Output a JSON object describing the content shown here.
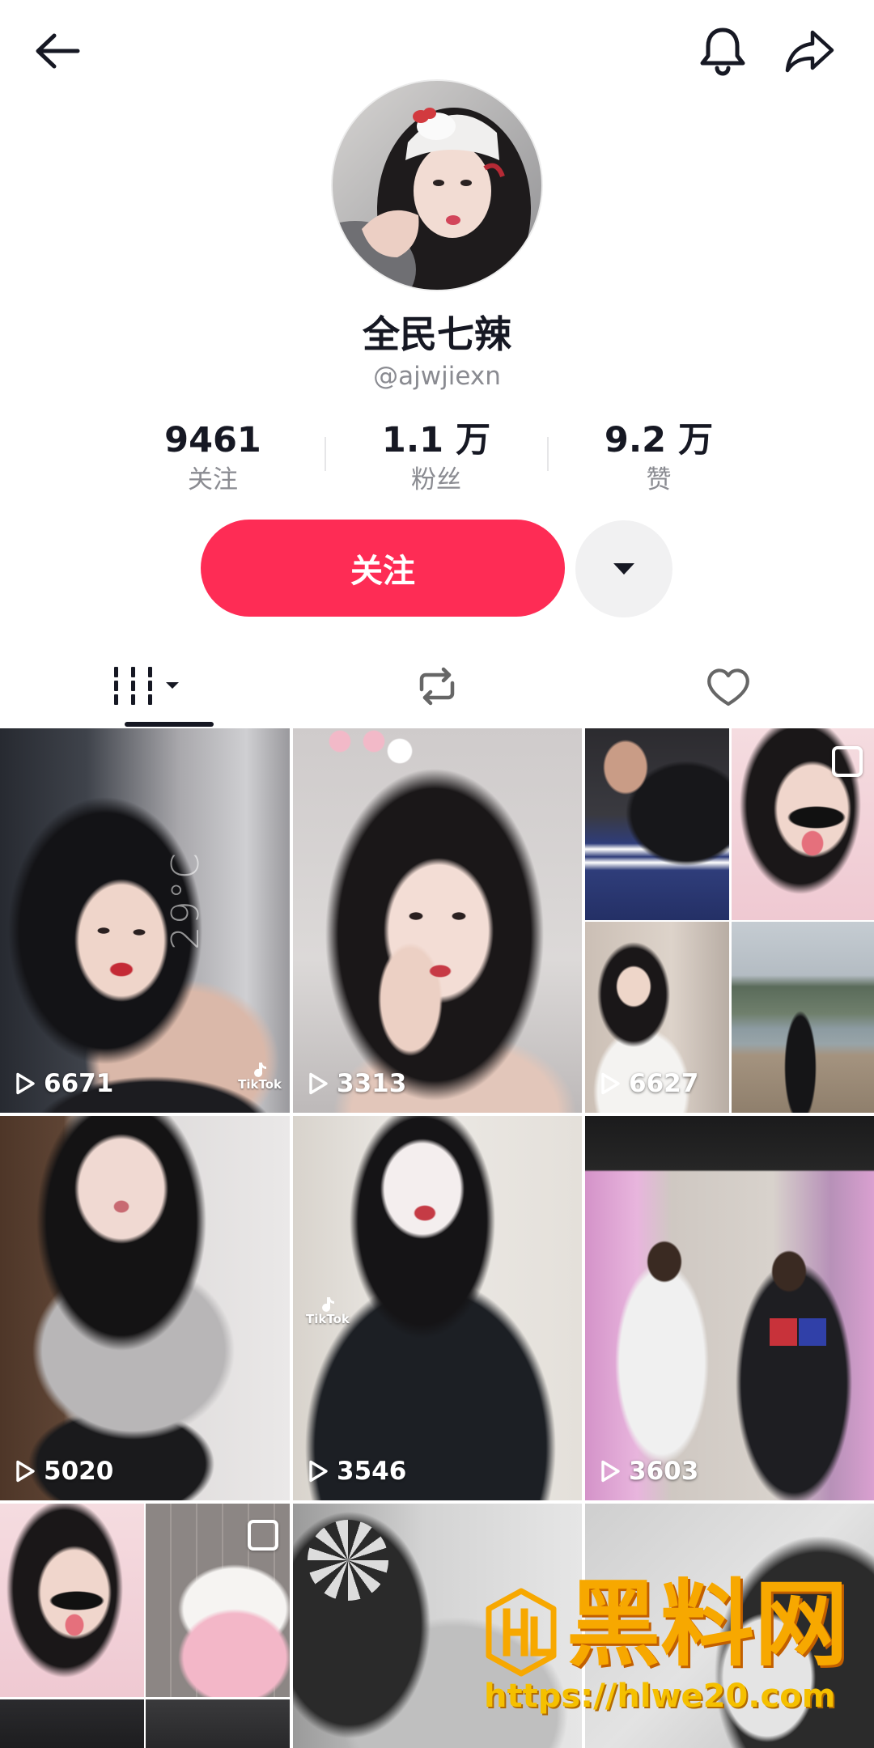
{
  "header": {
    "back_icon": "back-arrow-icon",
    "notification_icon": "bell-icon",
    "share_icon": "share-icon"
  },
  "profile": {
    "name": "全民七辣",
    "handle": "@ajwjiexn",
    "stats": [
      {
        "value": "9461",
        "label": "关注"
      },
      {
        "value": "1.1 万",
        "label": "粉丝"
      },
      {
        "value": "9.2 万",
        "label": "赞"
      }
    ]
  },
  "actions": {
    "follow_label": "关注",
    "more_icon": "triangle-down-icon"
  },
  "tabs": [
    {
      "icon": "videos-grid-icon",
      "active": true
    },
    {
      "icon": "repost-icon",
      "active": false
    },
    {
      "icon": "heart-icon",
      "active": false
    }
  ],
  "videos": [
    {
      "plays": "6671",
      "sticker": "29°C",
      "app_mark": "TikTok"
    },
    {
      "plays": "3313"
    },
    {
      "plays": "6627",
      "photo_mode": true
    },
    {
      "plays": "5020"
    },
    {
      "plays": "3546",
      "app_mark": "TikTok"
    },
    {
      "plays": "3603"
    },
    {
      "photo_mode": true
    },
    {},
    {}
  ],
  "watermark": {
    "brand": "黑料网",
    "url": "https://hlwe20.com"
  },
  "colors": {
    "accent": "#FE2C55",
    "text": "#161823",
    "muted": "#8a8b91",
    "watermark": "#F7A800"
  }
}
